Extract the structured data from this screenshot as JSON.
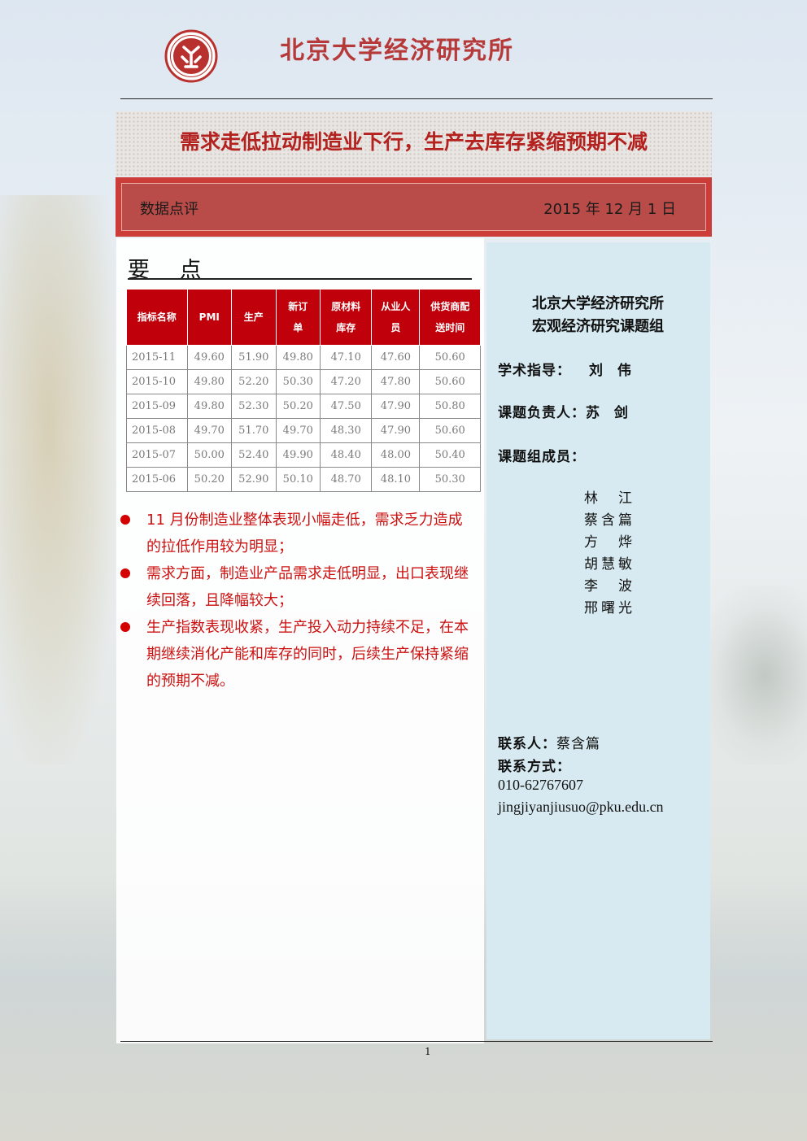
{
  "header": {
    "institute_name": "北京大学经济研究所",
    "logo_icon": "peking-university-seal-icon"
  },
  "report": {
    "title": "需求走低拉动制造业下行，生产去库存紧缩预期不减",
    "category": "数据点评",
    "date": "2015 年 12 月 1 日"
  },
  "key_points": {
    "heading": "要 点",
    "table": {
      "headers": [
        "指标名称",
        "PMI",
        "生产",
        "新订单",
        "原材料库存",
        "从业人员",
        "供货商配送时间"
      ],
      "header_lines": [
        [
          "指标名称"
        ],
        [
          "PMI"
        ],
        [
          "生产"
        ],
        [
          "新订",
          "单"
        ],
        [
          "原材料",
          "库存"
        ],
        [
          "从业人",
          "员"
        ],
        [
          "供货商配",
          "送时间"
        ]
      ],
      "rows": [
        [
          "2015-11",
          "49.60",
          "51.90",
          "49.80",
          "47.10",
          "47.60",
          "50.60"
        ],
        [
          "2015-10",
          "49.80",
          "52.20",
          "50.30",
          "47.20",
          "47.80",
          "50.60"
        ],
        [
          "2015-09",
          "49.80",
          "52.30",
          "50.20",
          "47.50",
          "47.90",
          "50.80"
        ],
        [
          "2015-08",
          "49.70",
          "51.70",
          "49.70",
          "48.30",
          "47.90",
          "50.60"
        ],
        [
          "2015-07",
          "50.00",
          "52.40",
          "49.90",
          "48.40",
          "48.00",
          "50.40"
        ],
        [
          "2015-06",
          "50.20",
          "52.90",
          "50.10",
          "48.70",
          "48.10",
          "50.30"
        ]
      ]
    },
    "bullets": [
      "11 月份制造业整体表现小幅走低，需求乏力造成的拉低作用较为明显；",
      "需求方面，制造业产品需求走低明显，出口表现继续回落，且降幅较大；",
      "生产指数表现收紧，生产投入动力持续不足，在本期继续消化产能和库存的同时，后续生产保持紧缩的预期不减。"
    ]
  },
  "sidebar": {
    "org_line1": "北京大学经济研究所",
    "org_line2": "宏观经济研究课题组",
    "advisor_label": "学术指导：",
    "advisor_name": "刘 伟",
    "lead_label": "课题负责人：",
    "lead_name": "苏 剑",
    "members_label": "课题组成员：",
    "members": [
      "林　江",
      "蔡含篇",
      "方　烨",
      "胡慧敏",
      "李　波",
      "邢曙光"
    ],
    "contact_label": "联系人：",
    "contact_name": "蔡含篇",
    "method_label": "联系方式：",
    "phone": "010-62767607",
    "email": "jingjiyanjiusuo@pku.edu.cn"
  },
  "footer": {
    "page_number": "1"
  },
  "colors": {
    "accent_red": "#c0000b",
    "bar_red": "#b94c48",
    "side_blue": "#d7eaf1"
  }
}
